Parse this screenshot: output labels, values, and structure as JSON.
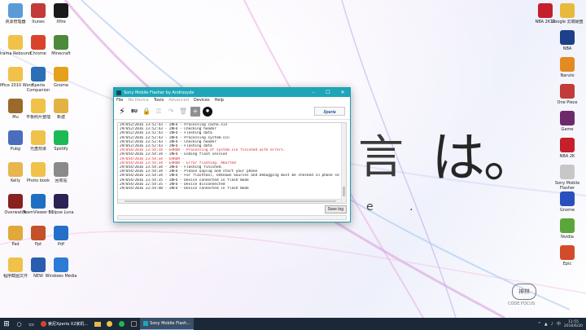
{
  "desktop": {
    "icons_left": [
      {
        "label": "资源管理器",
        "color": "#5b9bd5"
      },
      {
        "label": "Irama Rebound",
        "color": "#f0c24a"
      },
      {
        "label": "Office 2010 Word",
        "color": "#f2c14a"
      },
      {
        "label": "Mu",
        "color": "#9b6a2a"
      },
      {
        "label": "Pubg",
        "color": "#4a6dbd"
      },
      {
        "label": "Kelly",
        "color": "#e8b64d"
      },
      {
        "label": "Overwatch",
        "color": "#8a2121"
      },
      {
        "label": "Pad",
        "color": "#e0a93a"
      },
      {
        "label": "程序截图文件",
        "color": "#f0c24a"
      },
      {
        "label": "Itunes",
        "color": "#c23a3a"
      },
      {
        "label": "Chrome",
        "color": "#d9432c"
      },
      {
        "label": "Xperia Companion",
        "color": "#2a6fb8"
      },
      {
        "label": "平板照片整理",
        "color": "#f0c24a"
      },
      {
        "label": "光盘刻录",
        "color": "#f0c24a"
      },
      {
        "label": "Photo book",
        "color": "#f0c24a"
      },
      {
        "label": "TeamViewer 11",
        "color": "#1e6fc2"
      },
      {
        "label": "Ppt",
        "color": "#c4512a"
      },
      {
        "label": "NEW",
        "color": "#2a5db0"
      },
      {
        "label": "Xfire",
        "color": "#1a1a1a"
      },
      {
        "label": "Minecraft",
        "color": "#4b8a3a"
      },
      {
        "label": "Gnome",
        "color": "#e5a11c"
      },
      {
        "label": "新建",
        "color": "#e2b344"
      },
      {
        "label": "Spotify",
        "color": "#1db954"
      },
      {
        "label": "回收站",
        "color": "#8a8a8a"
      },
      {
        "label": "Eclipse Luna",
        "color": "#2c2255"
      },
      {
        "label": "Pdf",
        "color": "#2470c8"
      },
      {
        "label": "Windows Media",
        "color": "#2e7bd5"
      }
    ],
    "icons_right": [
      {
        "label": "NBA 2K16",
        "color": "#c41f2a"
      },
      {
        "label": "Google 云端硬盘",
        "color": "#e7b93d"
      },
      {
        "label": "NBA",
        "color": "#1e3f8a"
      },
      {
        "label": "Naruto",
        "color": "#e38a23"
      },
      {
        "label": "One Piece",
        "color": "#c23a3a"
      },
      {
        "label": "Game",
        "color": "#6c2a6a"
      },
      {
        "label": "NBA 2K",
        "color": "#c41f2a"
      },
      {
        "label": "Sony Mobile Flasher",
        "color": "#c7c7c7"
      },
      {
        "label": "Gnome",
        "color": "#2a4fbf"
      },
      {
        "label": "Nvidia",
        "color": "#5aa63a"
      },
      {
        "label": "Epic",
        "color": "#d24b2b"
      }
    ],
    "wallpaper_kana": "は。",
    "wallpaper_kana2": "言",
    "wallpaper_dots": "e .",
    "stamp_text": "神林",
    "stamp_sub": "CODE FOCUS"
  },
  "window": {
    "title": "Sony Mobile Flasher by Androxyde",
    "controls": {
      "minimize": "–",
      "maximize": "☐",
      "close": "✕"
    },
    "menu": [
      {
        "label": "File",
        "enabled": true
      },
      {
        "label": "No Device",
        "enabled": false
      },
      {
        "label": "Tools",
        "enabled": true
      },
      {
        "label": "Advanced",
        "enabled": false
      },
      {
        "label": "Devices",
        "enabled": true
      },
      {
        "label": "Help",
        "enabled": true
      }
    ],
    "toolbar": {
      "flash": "⚡",
      "dump": "BU",
      "lock": "🔒",
      "key": "⚿",
      "redo": "↷",
      "trash": "🗑",
      "add": "+",
      "bomb": "✹",
      "sony_logo": "Sony Xperia Logo"
    },
    "log": [
      {
        "text": "29/052/2016 23:52:43 - INFO - Processing cache.sin",
        "error": false
      },
      {
        "text": "29/052/2016 23:52:43 - INFO -    Checking header",
        "error": false
      },
      {
        "text": "29/052/2016 23:52:43 - INFO -    Flashing data",
        "error": false
      },
      {
        "text": "29/052/2016 23:52:43 - INFO - Processing system.sin",
        "error": false
      },
      {
        "text": "29/052/2016 23:52:43 - INFO -    Checking header",
        "error": false
      },
      {
        "text": "29/052/2016 23:52:43 - INFO -    Flashing data",
        "error": false
      },
      {
        "text": "29/054/2016 23:54:34 - ERROR - Processing of system.sin finished with errors.",
        "error": true
      },
      {
        "text": "29/054/2016 23:54:34 - INFO - Ending flash session",
        "error": false
      },
      {
        "text": "29/054/2016 23:54:34 - ERROR -",
        "error": true
      },
      {
        "text": "29/054/2016 23:54:34 - ERROR - Error flashing. Aborted",
        "error": true
      },
      {
        "text": "29/054/2016 23:54:34 - INFO - Flashing finished.",
        "error": false
      },
      {
        "text": "29/054/2016 23:54:34 - INFO - Please unplug and start your phone",
        "error": false
      },
      {
        "text": "29/054/2016 23:54:34 - INFO - For flashtool, Unknown Sources and Debugging must be checked in phone settings",
        "error": false
      },
      {
        "text": "29/054/2016 23:54:35 - INFO - Device connected in flash mode",
        "error": false
      },
      {
        "text": "29/054/2016 22:54:35 - INFO - Device disconnected",
        "error": false
      },
      {
        "text": "29/054/2016 23:54:40 - INFO - Device connected in flash mode",
        "error": false
      }
    ],
    "save_log_label": "Save log"
  },
  "taskbar": {
    "start": "⊞",
    "search": "○",
    "taskview": "▭",
    "tasks": [
      {
        "label": "索尼Xperia X2家机...",
        "active": false
      },
      {
        "label": "",
        "active": false
      },
      {
        "label": "",
        "active": false
      },
      {
        "label": "",
        "active": false
      },
      {
        "label": "Sony Mobile Flash...",
        "active": true
      }
    ],
    "tray_icons": [
      "^",
      "▲",
      "♪",
      "中"
    ],
    "time": "11:55",
    "date": "2016/6/20"
  }
}
